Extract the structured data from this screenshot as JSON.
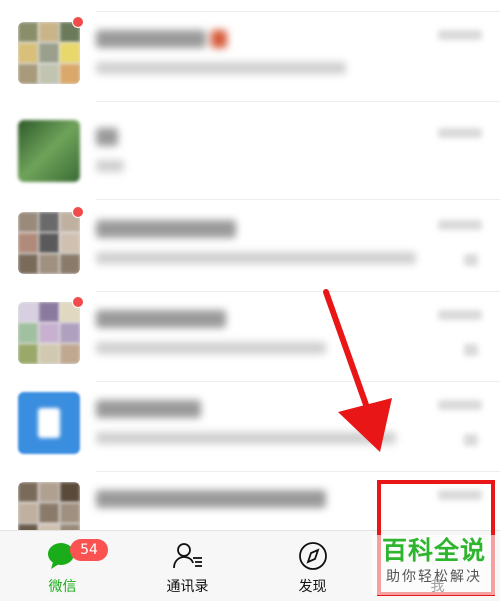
{
  "tabs": [
    {
      "label": "微信",
      "icon": "chat-bubble-icon",
      "badge": "54",
      "active": true
    },
    {
      "label": "通讯录",
      "icon": "contacts-icon",
      "active": false
    },
    {
      "label": "发现",
      "icon": "compass-icon",
      "active": false
    },
    {
      "label": "我",
      "icon": "person-icon",
      "active": false
    }
  ],
  "watermark": {
    "title": "百科全说",
    "subtitle": "助你轻松解决"
  },
  "colors": {
    "accent": "#1aad19",
    "badge": "#fa5151",
    "annotation": "#e81616"
  }
}
